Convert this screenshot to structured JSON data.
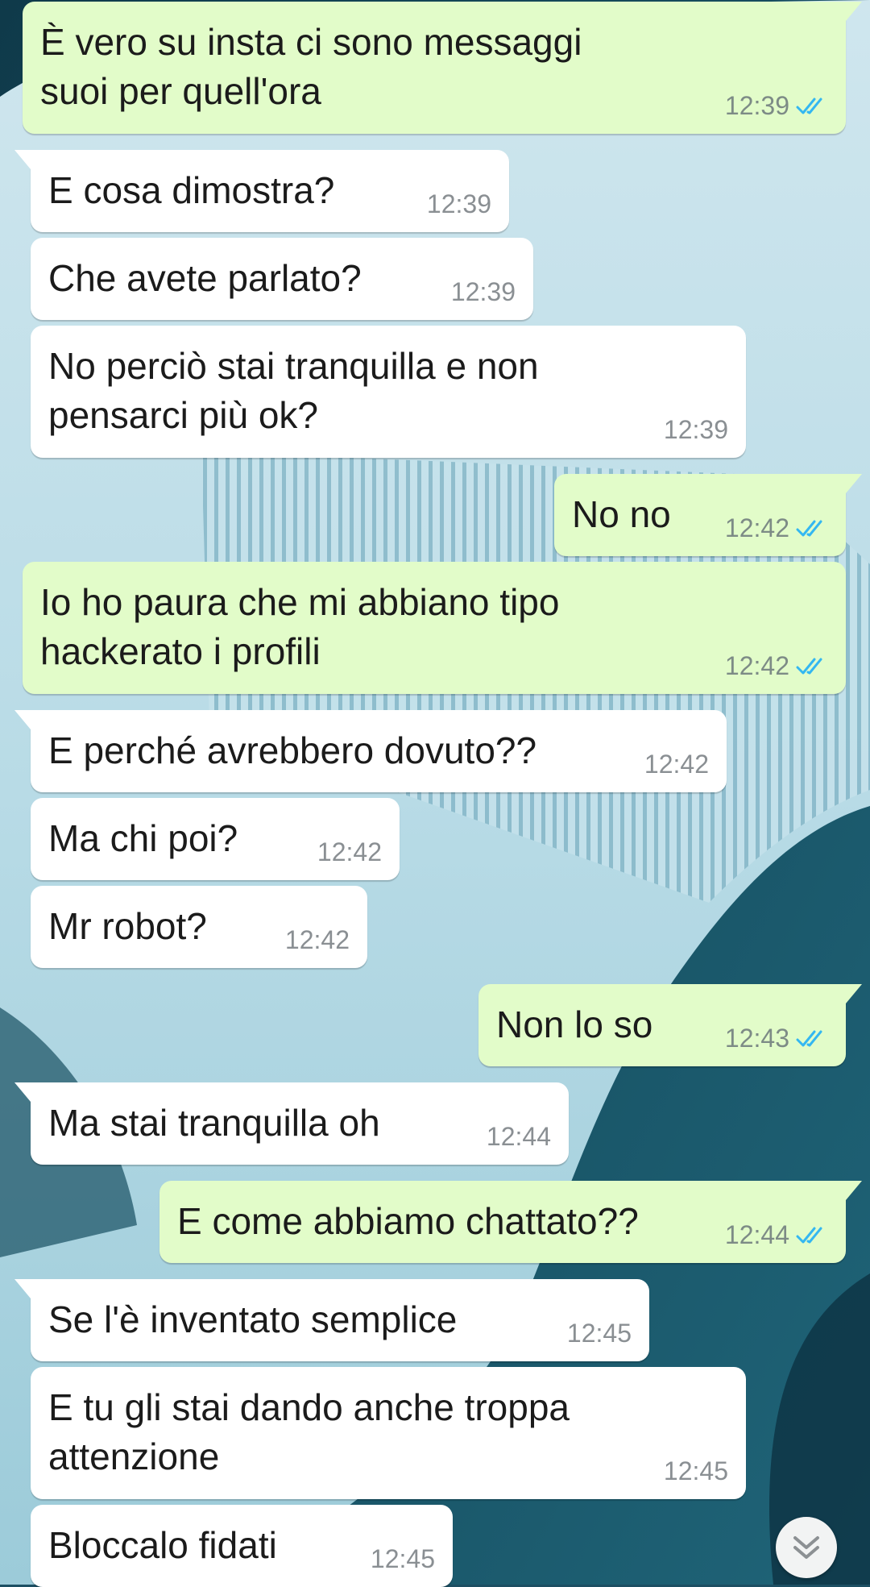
{
  "chat": {
    "messages": [
      {
        "dir": "out",
        "text": "È vero su insta ci sono messaggi\nsuoi per quell'ora",
        "time": "12:39",
        "status": "read"
      },
      {
        "dir": "in",
        "text": "E cosa dimostra?",
        "time": "12:39"
      },
      {
        "dir": "in",
        "text": "Che avete parlato?",
        "time": "12:39"
      },
      {
        "dir": "in",
        "text": "No perciò stai tranquilla e non\npensarci più ok?",
        "time": "12:39"
      },
      {
        "dir": "out",
        "text": "No no",
        "time": "12:42",
        "status": "read"
      },
      {
        "dir": "out",
        "text": "Io ho paura che mi abbiano tipo\nhackerato i profili",
        "time": "12:42",
        "status": "read"
      },
      {
        "dir": "in",
        "text": "E perché avrebbero dovuto??",
        "time": "12:42"
      },
      {
        "dir": "in",
        "text": "Ma chi poi?",
        "time": "12:42"
      },
      {
        "dir": "in",
        "text": "Mr robot?",
        "time": "12:42"
      },
      {
        "dir": "out",
        "text": "Non lo so",
        "time": "12:43",
        "status": "read"
      },
      {
        "dir": "in",
        "text": "Ma stai tranquilla oh",
        "time": "12:44"
      },
      {
        "dir": "out",
        "text": "E come abbiamo chattato??",
        "time": "12:44",
        "status": "read"
      },
      {
        "dir": "in",
        "text": "Se l'è inventato semplice",
        "time": "12:45"
      },
      {
        "dir": "in",
        "text": "E tu gli stai dando anche troppa\nattenzione",
        "time": "12:45"
      },
      {
        "dir": "in",
        "text": "Bloccalo fidati",
        "time": "12:45"
      }
    ]
  },
  "scroll_button": {
    "icon": "double-chevron-down-icon"
  },
  "colors": {
    "incoming_bubble": "#ffffff",
    "outgoing_bubble": "#e2fcc9",
    "read_ticks": "#34b7f1",
    "timestamp": "#8a8f93"
  }
}
